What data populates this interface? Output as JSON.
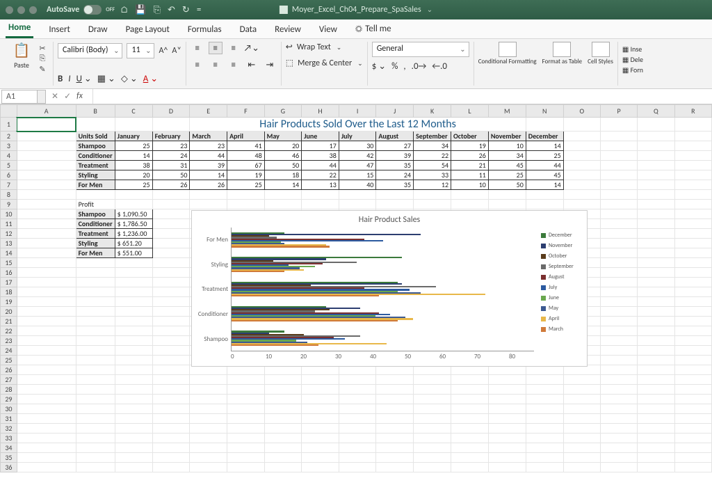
{
  "window": {
    "autosave_label": "AutoSave",
    "autosave_state": "OFF",
    "document_name": "Moyer_Excel_Ch04_Prepare_SpaSales"
  },
  "ribbon": {
    "tabs": [
      "Home",
      "Insert",
      "Draw",
      "Page Layout",
      "Formulas",
      "Data",
      "Review",
      "View"
    ],
    "active_tab": "Home",
    "tell_me": "Tell me",
    "paste_label": "Paste",
    "font_name": "Calibri (Body)",
    "font_size": "11",
    "wrap_text": "Wrap Text",
    "merge_center": "Merge & Center",
    "number_format": "General",
    "cond_fmt": "Conditional Formatting",
    "fmt_table": "Format as Table",
    "cell_styles": "Cell Styles",
    "side": {
      "insert": "Inse",
      "delete": "Dele",
      "format": "Forn"
    }
  },
  "refbar": {
    "name": "A1",
    "fx": "fx"
  },
  "sheet": {
    "columns": [
      "A",
      "B",
      "C",
      "D",
      "E",
      "F",
      "G",
      "H",
      "I",
      "J",
      "K",
      "L",
      "M",
      "N",
      "O",
      "P",
      "Q",
      "R"
    ],
    "title": "Hair Products Sold Over the Last 12 Months",
    "units_header": "Units Sold",
    "months": [
      "January",
      "February",
      "March",
      "April",
      "May",
      "June",
      "July",
      "August",
      "September",
      "October",
      "November",
      "December"
    ],
    "rows": [
      {
        "label": "Shampoo",
        "vals": [
          25,
          23,
          23,
          41,
          20,
          17,
          30,
          27,
          34,
          19,
          10,
          14
        ]
      },
      {
        "label": "Conditioner",
        "vals": [
          14,
          24,
          44,
          48,
          46,
          38,
          42,
          39,
          22,
          26,
          34,
          25
        ]
      },
      {
        "label": "Treatment",
        "vals": [
          38,
          31,
          39,
          67,
          50,
          44,
          47,
          35,
          54,
          21,
          45,
          44
        ]
      },
      {
        "label": "Styling",
        "vals": [
          20,
          50,
          14,
          19,
          18,
          22,
          15,
          24,
          33,
          11,
          25,
          45
        ]
      },
      {
        "label": "For Men",
        "vals": [
          25,
          26,
          26,
          25,
          14,
          13,
          40,
          35,
          12,
          10,
          50,
          14
        ]
      }
    ],
    "profit_header": "Profit",
    "profit": [
      {
        "label": "Shampoo",
        "val": "$ 1,090.50"
      },
      {
        "label": "Conditioner",
        "val": "$ 1,786.50"
      },
      {
        "label": "Treatment",
        "val": "$ 1,236.00"
      },
      {
        "label": "Styling",
        "val": "$    651.20"
      },
      {
        "label": "For Men",
        "val": "$    551.00"
      }
    ]
  },
  "chart_data": {
    "type": "bar",
    "title": "Hair Product Sales",
    "categories": [
      "For Men",
      "Styling",
      "Treatment",
      "Conditioner",
      "Shampoo"
    ],
    "series": [
      {
        "name": "December",
        "color": "#3b7a3b",
        "values": [
          14,
          45,
          44,
          25,
          14
        ]
      },
      {
        "name": "November",
        "color": "#2c3e70",
        "values": [
          50,
          25,
          45,
          34,
          10
        ]
      },
      {
        "name": "October",
        "color": "#5a3c1b",
        "values": [
          10,
          11,
          21,
          26,
          19
        ]
      },
      {
        "name": "September",
        "color": "#6a6a6a",
        "values": [
          12,
          33,
          54,
          22,
          34
        ]
      },
      {
        "name": "August",
        "color": "#7a2f2f",
        "values": [
          35,
          24,
          35,
          39,
          27
        ]
      },
      {
        "name": "July",
        "color": "#2c5aa0",
        "values": [
          40,
          15,
          47,
          42,
          30
        ]
      },
      {
        "name": "June",
        "color": "#6aa84f",
        "values": [
          13,
          22,
          44,
          38,
          17
        ]
      },
      {
        "name": "May",
        "color": "#3d5a91",
        "values": [
          14,
          18,
          50,
          46,
          20
        ]
      },
      {
        "name": "April",
        "color": "#e8b84a",
        "values": [
          25,
          19,
          67,
          48,
          41
        ]
      },
      {
        "name": "March",
        "color": "#d07a3a",
        "values": [
          26,
          14,
          39,
          44,
          23
        ]
      }
    ],
    "xlabel": "",
    "ylabel": "",
    "xlim": [
      0,
      80
    ],
    "xticks": [
      0,
      10,
      20,
      30,
      40,
      50,
      60,
      70,
      80
    ]
  }
}
